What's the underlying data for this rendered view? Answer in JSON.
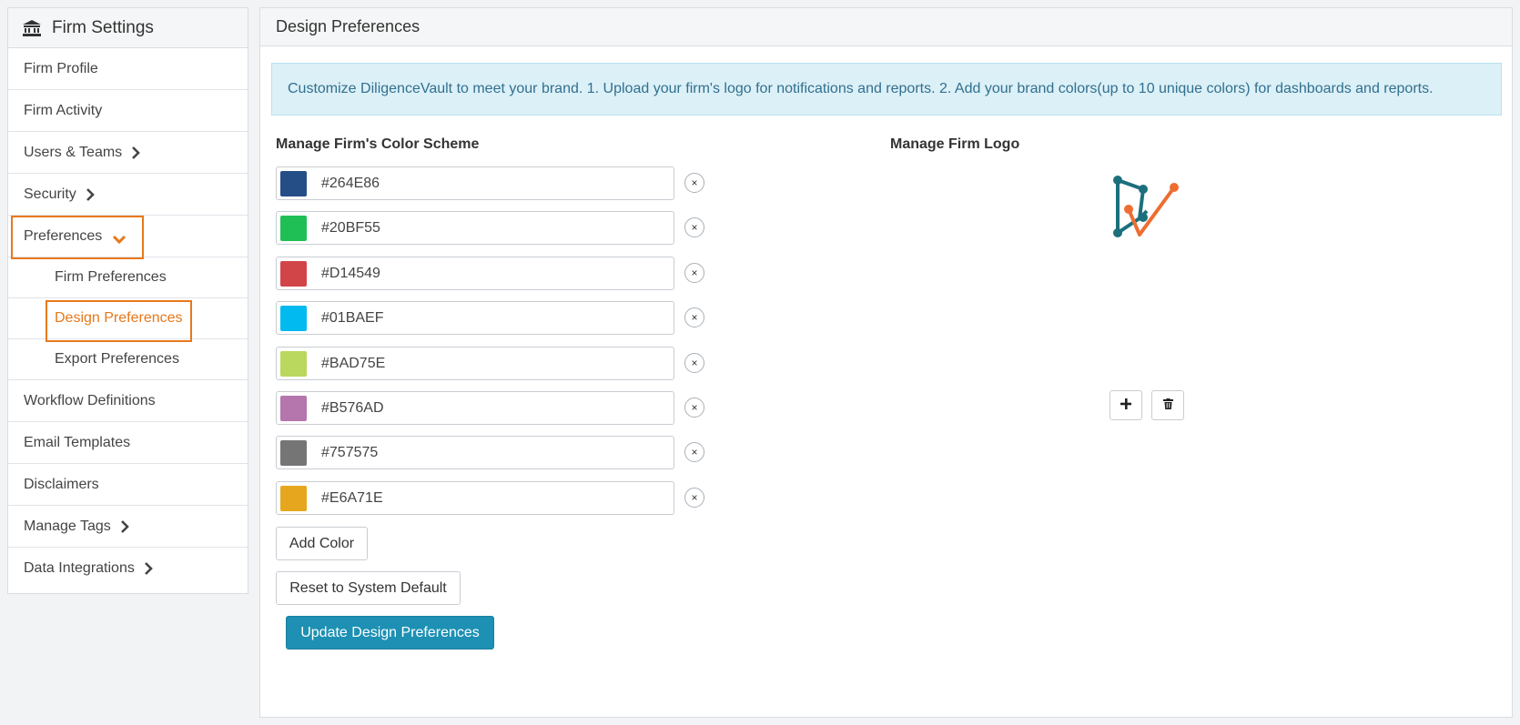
{
  "sidebar": {
    "title": "Firm Settings",
    "title_icon": "bank-icon",
    "items": [
      {
        "label": "Firm Profile"
      },
      {
        "label": "Firm Activity"
      },
      {
        "label": "Users & Teams",
        "icon": "chevron-right-icon"
      },
      {
        "label": "Security",
        "icon": "chevron-right-icon"
      },
      {
        "label": "Preferences",
        "icon": "chevron-down-icon"
      },
      {
        "label": "Firm Preferences"
      },
      {
        "label": "Design Preferences"
      },
      {
        "label": "Export Preferences"
      },
      {
        "label": "Workflow Definitions"
      },
      {
        "label": "Email Templates"
      },
      {
        "label": "Disclaimers"
      },
      {
        "label": "Manage Tags",
        "icon": "chevron-right-icon"
      },
      {
        "label": "Data Integrations",
        "icon": "chevron-right-icon"
      }
    ]
  },
  "main": {
    "title": "Design Preferences",
    "info": "Customize DiligenceVault to meet your brand. 1. Upload your firm's logo for notifications and reports. 2. Add your brand colors(up to 10 unique colors) for dashboards and reports.",
    "color_scheme_title": "Manage Firm's Color Scheme",
    "logo_title": "Manage Firm Logo",
    "colors": [
      {
        "value": "#264E86"
      },
      {
        "value": "#20BF55"
      },
      {
        "value": "#D14549"
      },
      {
        "value": "#01BAEF"
      },
      {
        "value": "#BAD75E"
      },
      {
        "value": "#B576AD"
      },
      {
        "value": "#757575"
      },
      {
        "value": "#E6A71E"
      }
    ],
    "remove_label": "×",
    "add_color_label": "Add Color",
    "reset_label": "Reset to System Default",
    "update_label": "Update Design Preferences",
    "logo_add_icon": "plus-icon",
    "logo_delete_icon": "trash-icon"
  },
  "accent_color": "#E8781A",
  "primary_color": "#1D90B3"
}
